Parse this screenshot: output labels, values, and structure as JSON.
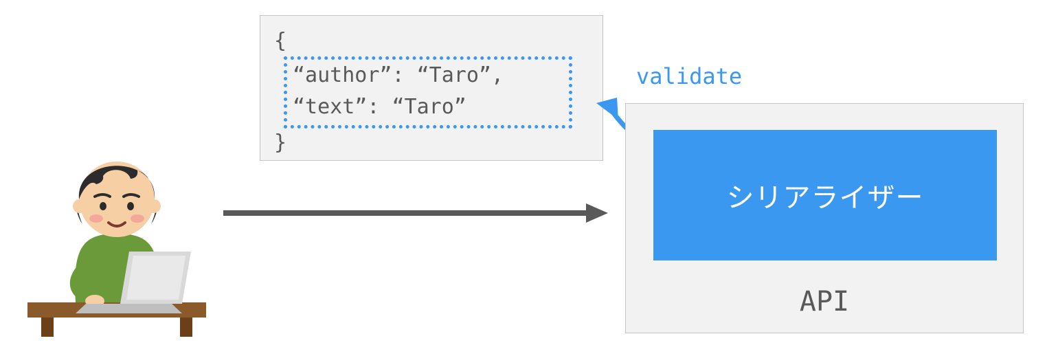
{
  "code": {
    "open": "{",
    "line1": "“author”: “Taro”,",
    "line2": "“text”: “Taro”",
    "close": "}"
  },
  "validate_label": "validate",
  "api": {
    "serializer_label": "シリアライザー",
    "api_label": "API"
  },
  "colors": {
    "accent": "#3a98f0",
    "box_bg": "#f2f2f2",
    "box_border": "#c5c5c5",
    "text_gray": "#595959",
    "arrow_gray": "#595959"
  }
}
